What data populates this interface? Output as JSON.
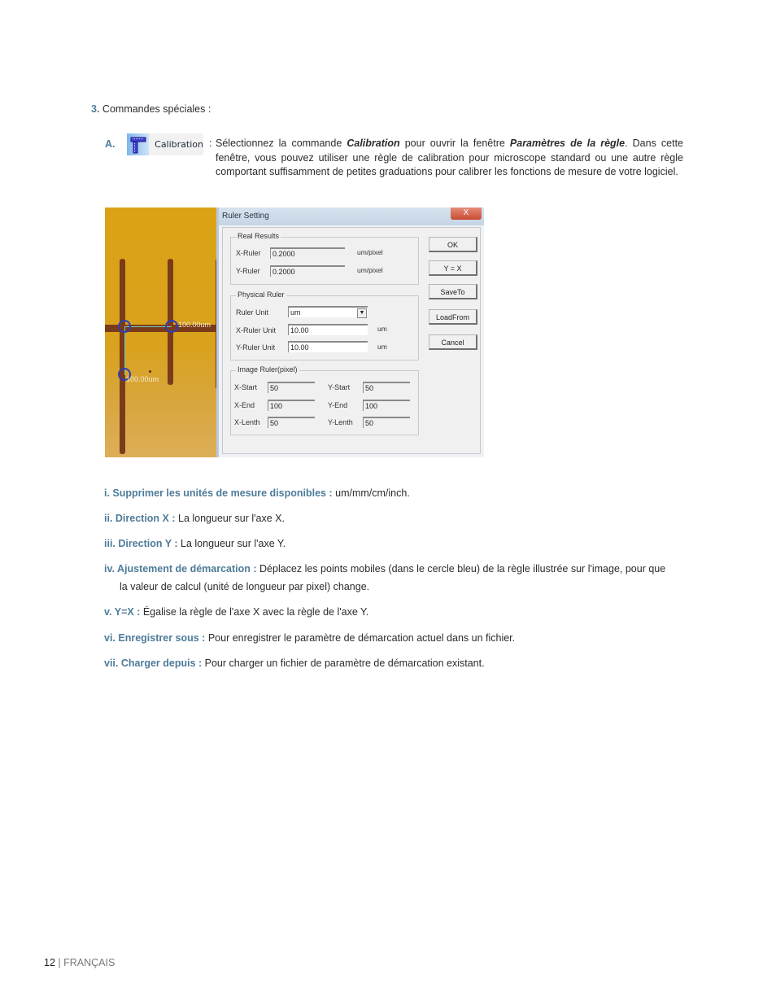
{
  "section": {
    "number": "3.",
    "title": "Commandes spéciales :"
  },
  "item_a": {
    "letter": "A.",
    "button": {
      "icon": "ruler-square-icon",
      "label": "Calibration"
    },
    "colon": ":",
    "text_1": "Sélectionnez la commande ",
    "text_bold_1": "Calibration",
    "text_2": " pour ouvrir la fenêtre ",
    "text_bold_2": "Paramètres de la règle",
    "text_3": ". Dans cette fenêtre, vous pouvez utiliser une règle de calibration pour microscope standard ou une autre règle comportant suffisamment de petites graduations pour calibrer les fonctions de mesure de votre logiciel."
  },
  "figure": {
    "micro_labels": [
      "100.00um",
      "100.00um"
    ],
    "dialog": {
      "title": "Ruler Setting",
      "close": "X",
      "real_results": {
        "legend": "Real Results",
        "x_label": "X-Ruler",
        "x_value": "0.2000",
        "x_unit": "um/pixel",
        "y_label": "Y-Ruler",
        "y_value": "0.2000",
        "y_unit": "um/pixel"
      },
      "physical_ruler": {
        "legend": "Physical Ruler",
        "unit_label": "Ruler Unit",
        "unit_value": "um",
        "x_label": "X-Ruler Unit",
        "x_value": "10.00",
        "x_unit": "um",
        "y_label": "Y-Ruler Unit",
        "y_value": "10.00",
        "y_unit": "um"
      },
      "image_ruler": {
        "legend": "Image Ruler(pixel)",
        "x_start_label": "X-Start",
        "x_start": "50",
        "x_end_label": "X-End",
        "x_end": "100",
        "x_len_label": "X-Lenth",
        "x_len": "50",
        "y_start_label": "Y-Start",
        "y_start": "50",
        "y_end_label": "Y-End",
        "y_end": "100",
        "y_len_label": "Y-Lenth",
        "y_len": "50"
      },
      "buttons": [
        "OK",
        "Y = X",
        "SaveTo",
        "LoadFrom",
        "Cancel"
      ]
    }
  },
  "list": [
    {
      "lead": "i.  Supprimer les unités de mesure disponibles :",
      "text": " um/mm/cm/inch."
    },
    {
      "lead": "ii.  Direction X :",
      "text": " La longueur sur l'axe X."
    },
    {
      "lead": "iii.  Direction Y :",
      "text": " La longueur sur l'axe Y."
    },
    {
      "lead": "iv.  Ajustement de démarcation :",
      "text": " Déplacez les points mobiles (dans le cercle bleu) de la règle illustrée sur l'image, pour que",
      "cont": "la valeur de calcul (unité de longueur par pixel) change."
    },
    {
      "lead": "v.  Y=X :",
      "text": " Égalise la règle de l'axe X avec la règle de l'axe Y."
    },
    {
      "lead": "vi.  Enregistrer sous :",
      "text": " Pour enregistrer le paramètre de démarcation actuel dans un fichier."
    },
    {
      "lead": "vii.  Charger depuis :",
      "text": " Pour charger un fichier de paramètre de démarcation existant."
    }
  ],
  "footer": {
    "page": "12",
    "sep": " | ",
    "language": "FRANÇAIS"
  }
}
